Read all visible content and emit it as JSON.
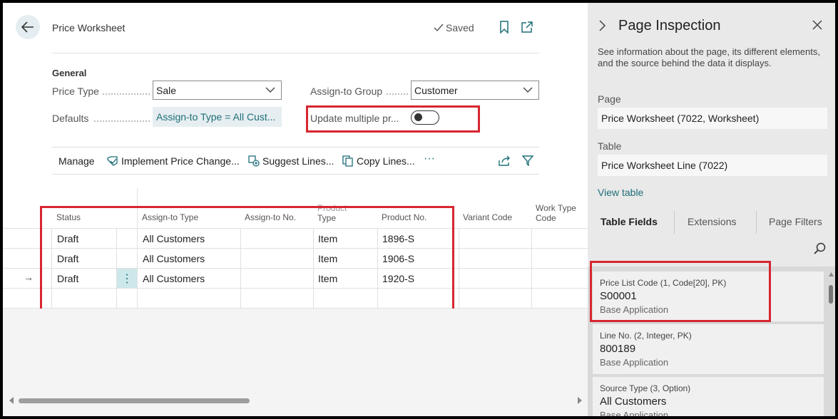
{
  "header": {
    "title": "Price Worksheet",
    "saved_label": "Saved"
  },
  "general": {
    "section_title": "General",
    "price_type_label": "Price Type",
    "price_type_value": "Sale",
    "assign_group_label": "Assign-to Group",
    "assign_group_value": "Customer",
    "defaults_label": "Defaults",
    "defaults_value": "Assign-to Type = All Cust...",
    "update_multiple_label": "Update multiple pr..."
  },
  "actions": {
    "manage": "Manage",
    "implement": "Implement Price Change...",
    "suggest": "Suggest Lines...",
    "copy": "Copy Lines...",
    "more": "···"
  },
  "table": {
    "headers": {
      "status": "Status",
      "assign_type": "Assign-to Type",
      "assign_no": "Assign-to No.",
      "product_type_1": "Product",
      "product_type_2": "Type",
      "product_no": "Product No.",
      "variant": "Variant Code",
      "work_type_1": "Work Type",
      "work_type_2": "Code"
    },
    "rows": [
      {
        "status": "Draft",
        "assign_type": "All Customers",
        "product_type": "Item",
        "product_no": "1896-S"
      },
      {
        "status": "Draft",
        "assign_type": "All Customers",
        "product_type": "Item",
        "product_no": "1906-S"
      },
      {
        "status": "Draft",
        "assign_type": "All Customers",
        "product_type": "Item",
        "product_no": "1920-S"
      }
    ],
    "row_menu_glyph": "⋮",
    "current_row_glyph": "→"
  },
  "panel": {
    "title": "Page Inspection",
    "description": "See information about the page, its different elements, and the source behind the data it displays.",
    "page_label": "Page",
    "page_value": "Price Worksheet (7022, Worksheet)",
    "table_label": "Table",
    "table_value": "Price Worksheet Line (7022)",
    "view_table": "View table",
    "tabs": [
      "Table Fields",
      "Extensions",
      "Page Filters"
    ],
    "fields": [
      {
        "name": "Price List Code (1, Code[20], PK)",
        "value": "S00001",
        "source": "Base Application"
      },
      {
        "name": "Line No. (2, Integer, PK)",
        "value": "800189",
        "source": "Base Application"
      },
      {
        "name": "Source Type (3, Option)",
        "value": "All Customers",
        "source": "Base Application"
      }
    ]
  },
  "colors": {
    "accent": "#1f6f78",
    "highlight_red": "#d7262f",
    "panel_bg": "#e9e9e9"
  }
}
